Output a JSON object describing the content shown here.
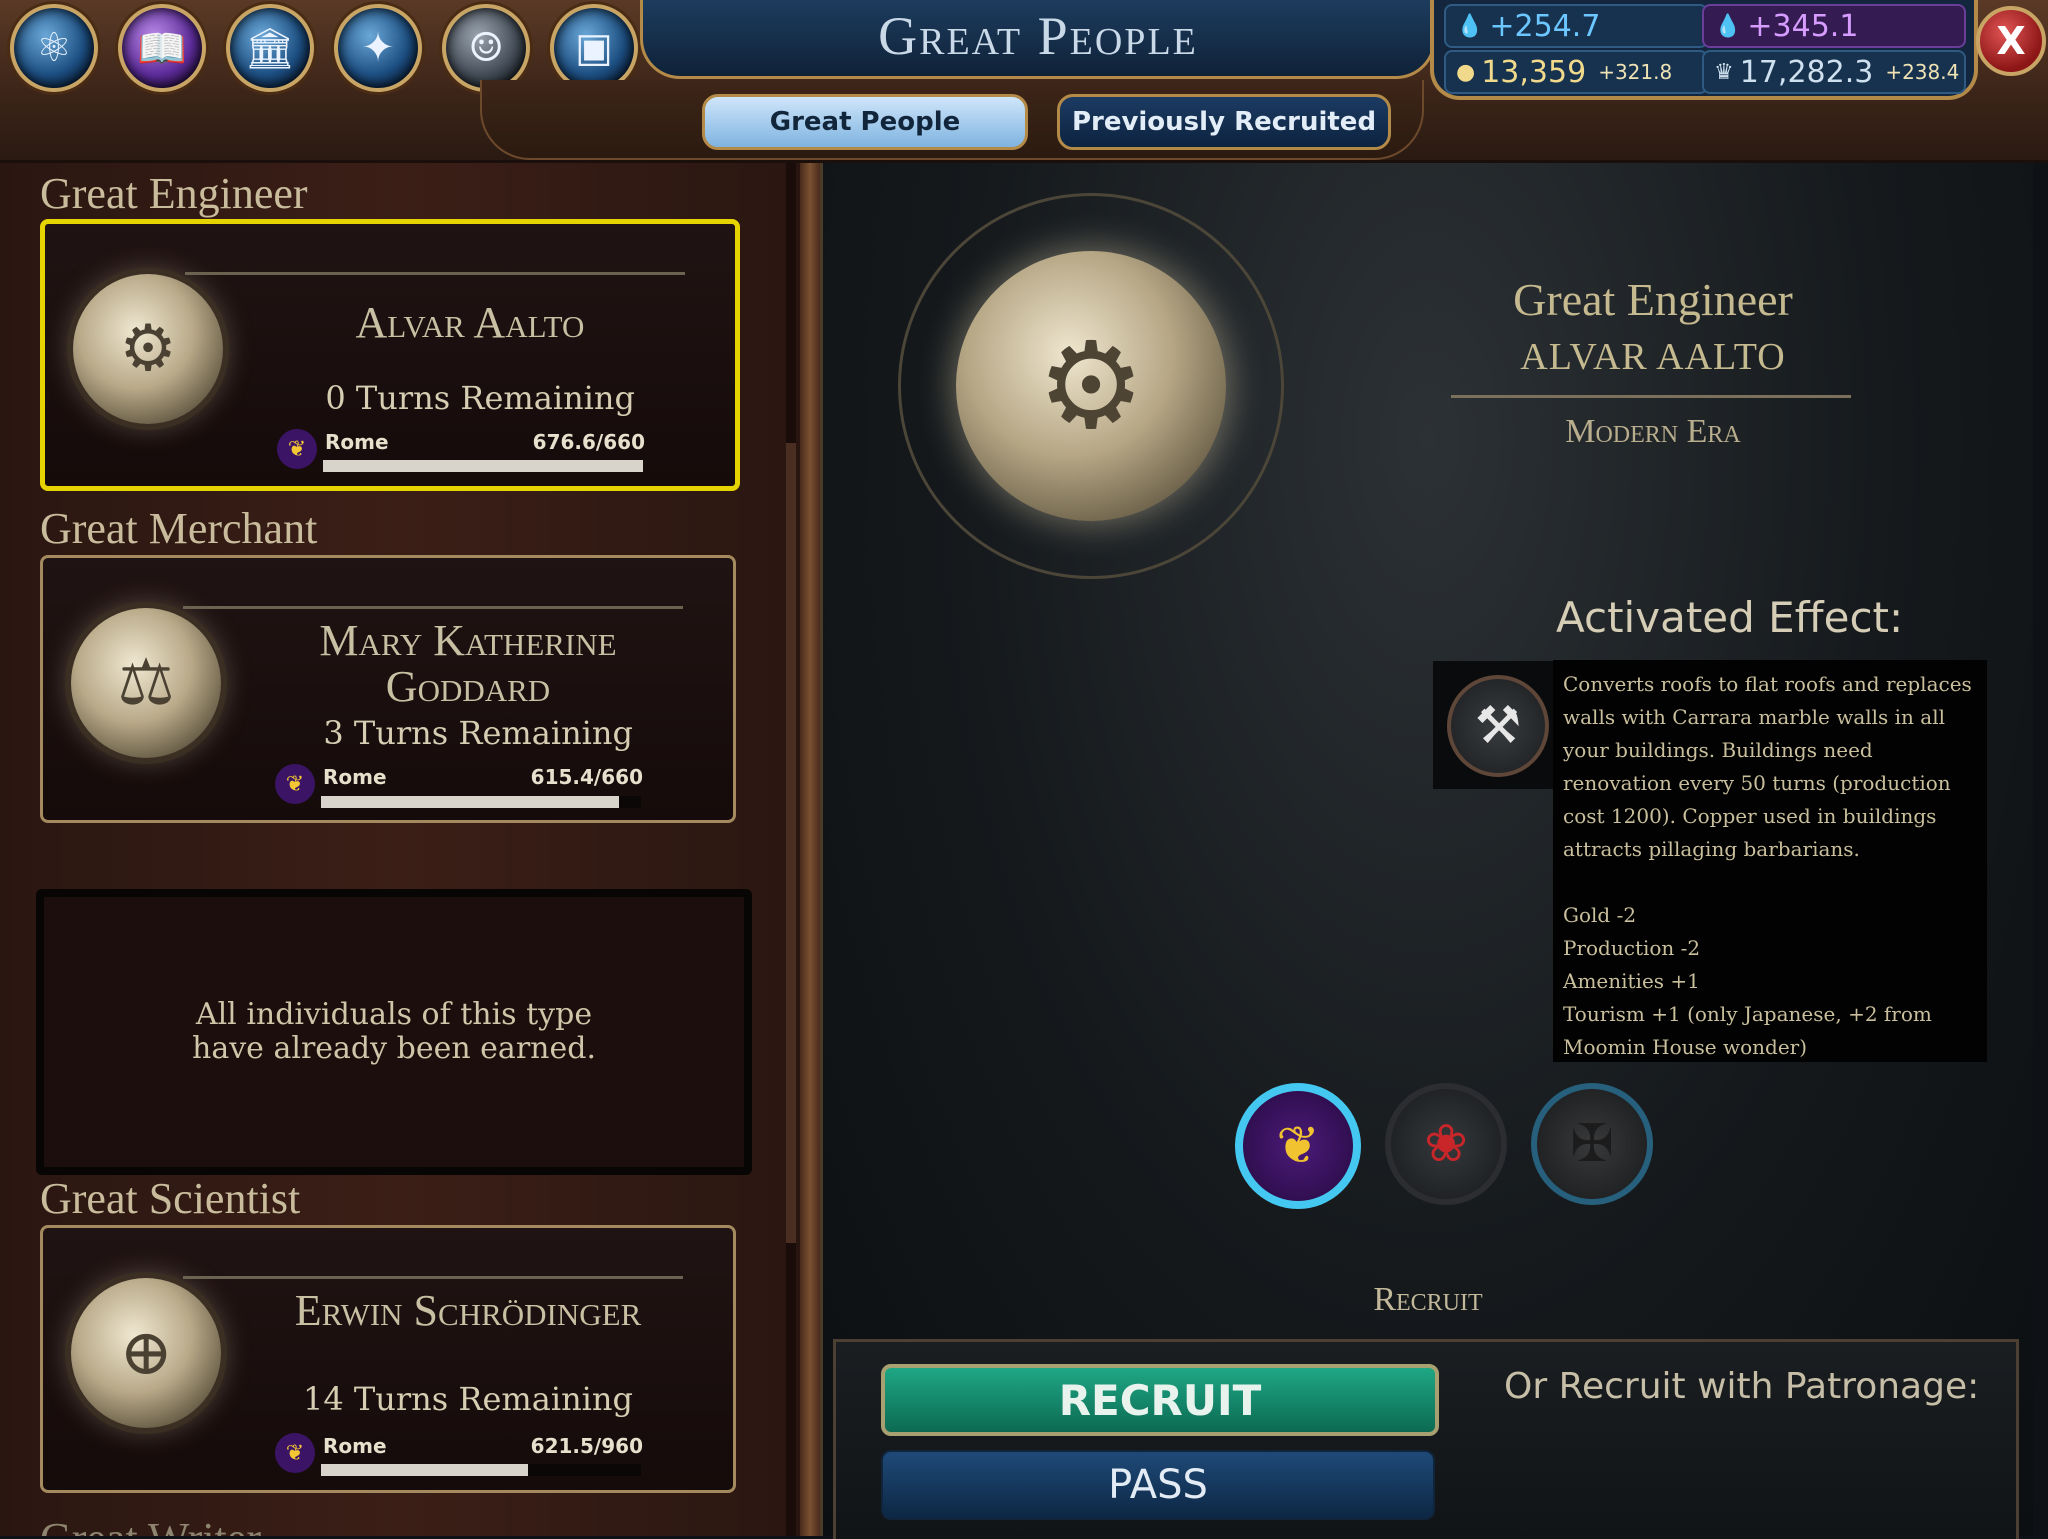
{
  "header": {
    "title": "Great People",
    "tabs": [
      {
        "label": "Great People",
        "active": true
      },
      {
        "label": "Previously Recruited",
        "active": false
      }
    ],
    "lens_icons": [
      "science-atom-icon",
      "civics-book-icon",
      "government-building-icon",
      "religion-angel-icon",
      "great-person-bust-icon",
      "great-works-painting-icon"
    ],
    "close_label": "X"
  },
  "resources": {
    "science": "+254.7",
    "faith": "+345.1",
    "gold_total": "13,359",
    "gold_rate": "+321.8",
    "tourism_total": "17,282.3",
    "tourism_rate": "+238.4"
  },
  "candidates": [
    {
      "category": "Great Engineer",
      "name": "Alvar Aalto",
      "turns": "0 Turns Remaining",
      "city": "Rome",
      "points": "676.6/660",
      "progress": 1.0,
      "icon": "engineer-medal-icon",
      "selected": true
    },
    {
      "category": "Great Merchant",
      "name": "Mary Katherine Goddard",
      "turns": "3 Turns Remaining",
      "city": "Rome",
      "points": "615.4/660",
      "progress": 0.932,
      "icon": "merchant-medal-icon",
      "selected": false
    },
    {
      "category": "Great Scientist",
      "name": "Erwin Schrödinger",
      "turns": "14 Turns Remaining",
      "city": "Rome",
      "points": "621.5/960",
      "progress": 0.647,
      "icon": "scientist-medal-icon",
      "selected": false
    }
  ],
  "earned_message": "All individuals of this type\nhave already been earned.",
  "next_category": "Great Writer",
  "detail": {
    "type": "Great Engineer",
    "name": "ALVAR AALTO",
    "era": "Modern Era",
    "effect_title": "Activated Effect:",
    "effect_paragraph": "Converts roofs to flat roofs and replaces walls with Carrara marble walls in all your buildings. Buildings need renovation every 50 turns (production cost 1200). Copper used in buildings attracts pillaging barbarians.",
    "effect_lines": [
      "Gold -2",
      "Production -2",
      "Amenities +1",
      "Tourism +1 (only Japanese, +2 from Moomin House wonder)"
    ],
    "effect_icon": "hammer-wrench-icon",
    "civ_icons": [
      "rome-civ-icon",
      "japan-civ-icon",
      "germany-civ-icon"
    ]
  },
  "actions": {
    "section_label": "Recruit",
    "recruit": "RECRUIT",
    "pass": "PASS",
    "patronage": "Or Recruit with Patronage:"
  }
}
